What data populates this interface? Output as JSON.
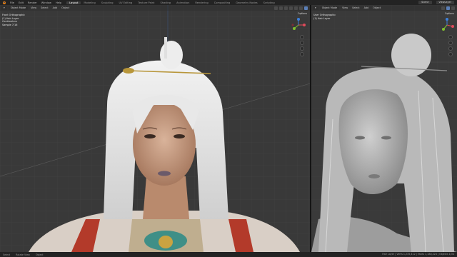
{
  "topbar": {
    "menus": [
      "File",
      "Edit",
      "Render",
      "Window",
      "Help"
    ],
    "workspaces": [
      "Layout",
      "Modeling",
      "Sculpting",
      "UV Editing",
      "Texture Paint",
      "Shading",
      "Animation",
      "Rendering",
      "Compositing",
      "Geometry Nodes",
      "Scripting"
    ],
    "active_workspace": "Layout",
    "scene": "Scene",
    "view_layer": "ViewLayer"
  },
  "left_viewport": {
    "mode": "Object Mode",
    "menus": [
      "View",
      "Select",
      "Add",
      "Object"
    ],
    "overlay_lines": [
      "Front Orthographic",
      "(1) Hair Layer",
      "Centimeters",
      "Sample 7/16"
    ],
    "options": "Options"
  },
  "right_viewport": {
    "mode": "Object Mode",
    "menus": [
      "View",
      "Select",
      "Add",
      "Object"
    ],
    "overlay_lines": [
      "User Orthographic",
      "(1) Hair Layer"
    ],
    "options": "Options"
  },
  "statusbar": {
    "items": [
      "Select",
      "Rotate View",
      "Object"
    ],
    "right_text": "Hair Layer | Verts 1,235,412 | Faces 1,180,224 | Objects 1/34"
  },
  "colors": {
    "accent": "#e87d0d",
    "viewport_bg": "#393939",
    "axis_x": "#e04a5a",
    "axis_y": "#7fbf2f",
    "axis_z": "#3d7fd9"
  }
}
